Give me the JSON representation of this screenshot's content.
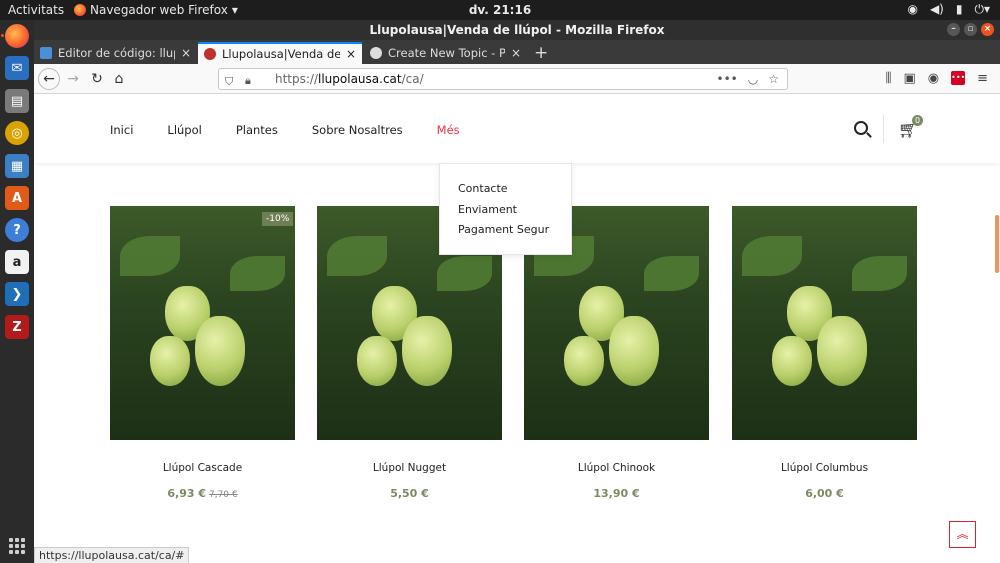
{
  "system_bar": {
    "activities": "Activitats",
    "app_menu": "Navegador web Firefox",
    "clock": "dv. 21:16"
  },
  "window": {
    "title": "Llupolausa|Venda de llúpol - Mozilla Firefox"
  },
  "tabs": [
    {
      "label": "Editor de código: llupola",
      "active": false
    },
    {
      "label": "Llupolausa|Venda de llúp",
      "active": true
    },
    {
      "label": "Create New Topic - Presta",
      "active": false
    }
  ],
  "url": {
    "prefix": "https://",
    "host": "llupolausa.cat",
    "path": "/ca/"
  },
  "site": {
    "menu": [
      "Inici",
      "Llúpol",
      "Plantes",
      "Sobre Nosaltres",
      "Més"
    ],
    "cart_count": "0",
    "dropdown": [
      "Contacte",
      "Enviament",
      "Pagament Segur"
    ]
  },
  "products": [
    {
      "name": "Llúpol Cascade",
      "price": "6,93 €",
      "old_price": "7,70 €",
      "discount": "-10%"
    },
    {
      "name": "Llúpol Nugget",
      "price": "5,50 €"
    },
    {
      "name": "Llúpol Chinook",
      "price": "13,90 €"
    },
    {
      "name": "Llúpol Columbus",
      "price": "6,00 €"
    }
  ],
  "status_link": "https://llupolausa.cat/ca/#"
}
